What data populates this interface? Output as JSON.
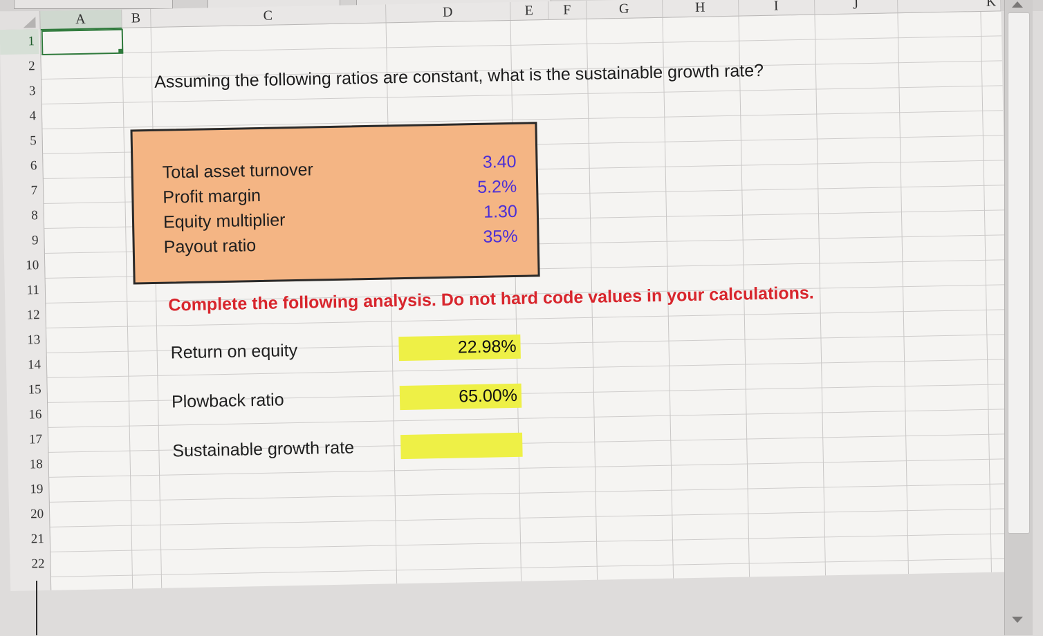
{
  "columns": [
    "A",
    "B",
    "C",
    "D",
    "E",
    "F",
    "G",
    "H",
    "I",
    "J",
    "K"
  ],
  "rows": [
    "1",
    "2",
    "3",
    "4",
    "5",
    "6",
    "7",
    "8",
    "9",
    "10",
    "11",
    "12",
    "13",
    "14",
    "15",
    "16",
    "17",
    "18",
    "19",
    "20",
    "21",
    "22"
  ],
  "question": "Assuming the following ratios are constant, what is the sustainable growth rate?",
  "ratios": [
    {
      "label": "Total asset turnover",
      "value": "3.40"
    },
    {
      "label": "Profit margin",
      "value": "5.2%"
    },
    {
      "label": "Equity multiplier",
      "value": "1.30"
    },
    {
      "label": "Payout ratio",
      "value": "35%"
    }
  ],
  "instruction": "Complete the following analysis. Do not hard code values in your calculations.",
  "analysis": [
    {
      "label": "Return on equity",
      "value": "22.98%"
    },
    {
      "label": "Plowback ratio",
      "value": "65.00%"
    },
    {
      "label": "Sustainable growth rate",
      "value": ""
    }
  ],
  "colors": {
    "ratio_box": "#f4b584",
    "ratio_values": "#4b2fd6",
    "instruction_text": "#d8262d",
    "input_cells": "#eef046",
    "selection": "#2f7a3c"
  },
  "icons": [
    "scroll-up-arrow-icon",
    "scroll-down-arrow-icon"
  ]
}
